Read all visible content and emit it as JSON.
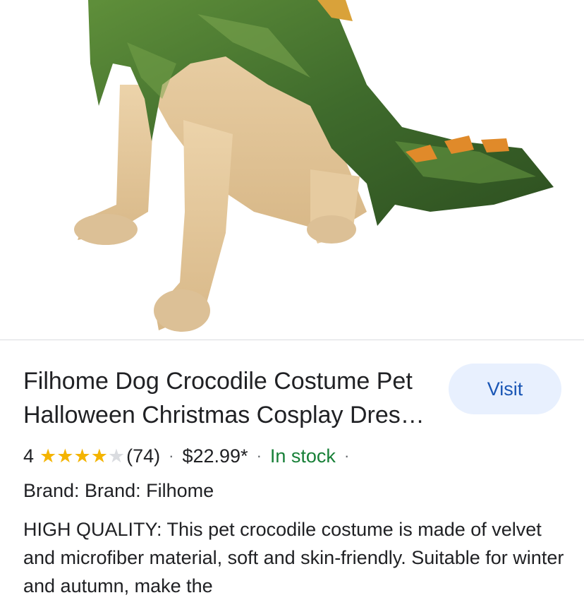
{
  "product": {
    "title": "Filhome Dog Crocodile Costume Pet Halloween Christmas Cosplay Dress Funny Party Apparel Outfit",
    "visit_label": "Visit",
    "rating_value": "4",
    "rating_stars": 4,
    "rating_max": 5,
    "review_count": "(74)",
    "separator": "·",
    "price": "$22.99*",
    "availability": "In stock",
    "brand_line": "Brand: Brand: Filhome",
    "description": "HIGH QUALITY: This pet crocodile costume is made of velvet and microfiber material, soft and skin-friendly. Suitable for winter and autumn, make the"
  },
  "colors": {
    "accent": "#1a56b5",
    "visit_bg": "#e8f0fe",
    "stock": "#188038",
    "star": "#f4b400",
    "costume_green": "#3f6b2c",
    "dog_fur": "#e2c59a"
  },
  "icons": {
    "star": "star-icon"
  }
}
